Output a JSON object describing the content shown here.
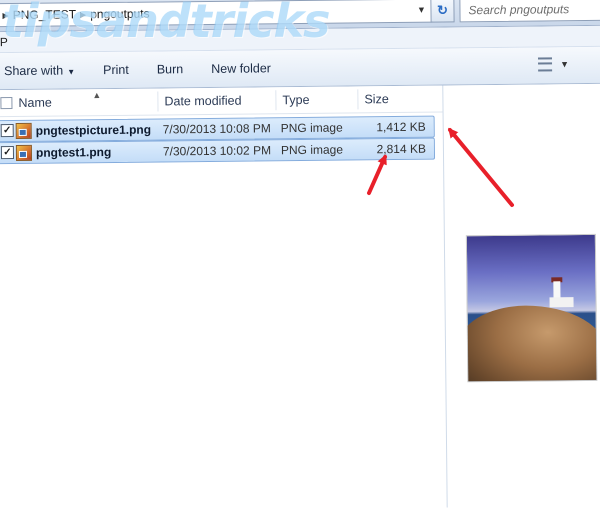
{
  "address_bar": {
    "crumbs": [
      "PNG_TEST",
      "pngoutputs"
    ],
    "search_placeholder": "Search pngoutputs"
  },
  "menubar": {
    "stub": "P"
  },
  "toolbar": {
    "share_with": "Share with",
    "print": "Print",
    "burn": "Burn",
    "new_folder": "New folder"
  },
  "columns": {
    "name": "Name",
    "date_modified": "Date modified",
    "type": "Type",
    "size": "Size"
  },
  "files": [
    {
      "name": "pngtestpicture1.png",
      "date": "7/30/2013 10:08 PM",
      "type": "PNG image",
      "size": "1,412 KB",
      "checked": "✓"
    },
    {
      "name": "pngtest1.png",
      "date": "7/30/2013 10:02 PM",
      "type": "PNG image",
      "size": "2,814 KB",
      "checked": "✓"
    }
  ],
  "icons": {
    "refresh": "refresh-icon",
    "view": "view-options-icon",
    "file": "png-file-icon"
  },
  "colors": {
    "selection": "#c4ddf8",
    "selection_border": "#84acdd",
    "arrow": "#e8202a"
  },
  "watermark": "tipsandtricks"
}
